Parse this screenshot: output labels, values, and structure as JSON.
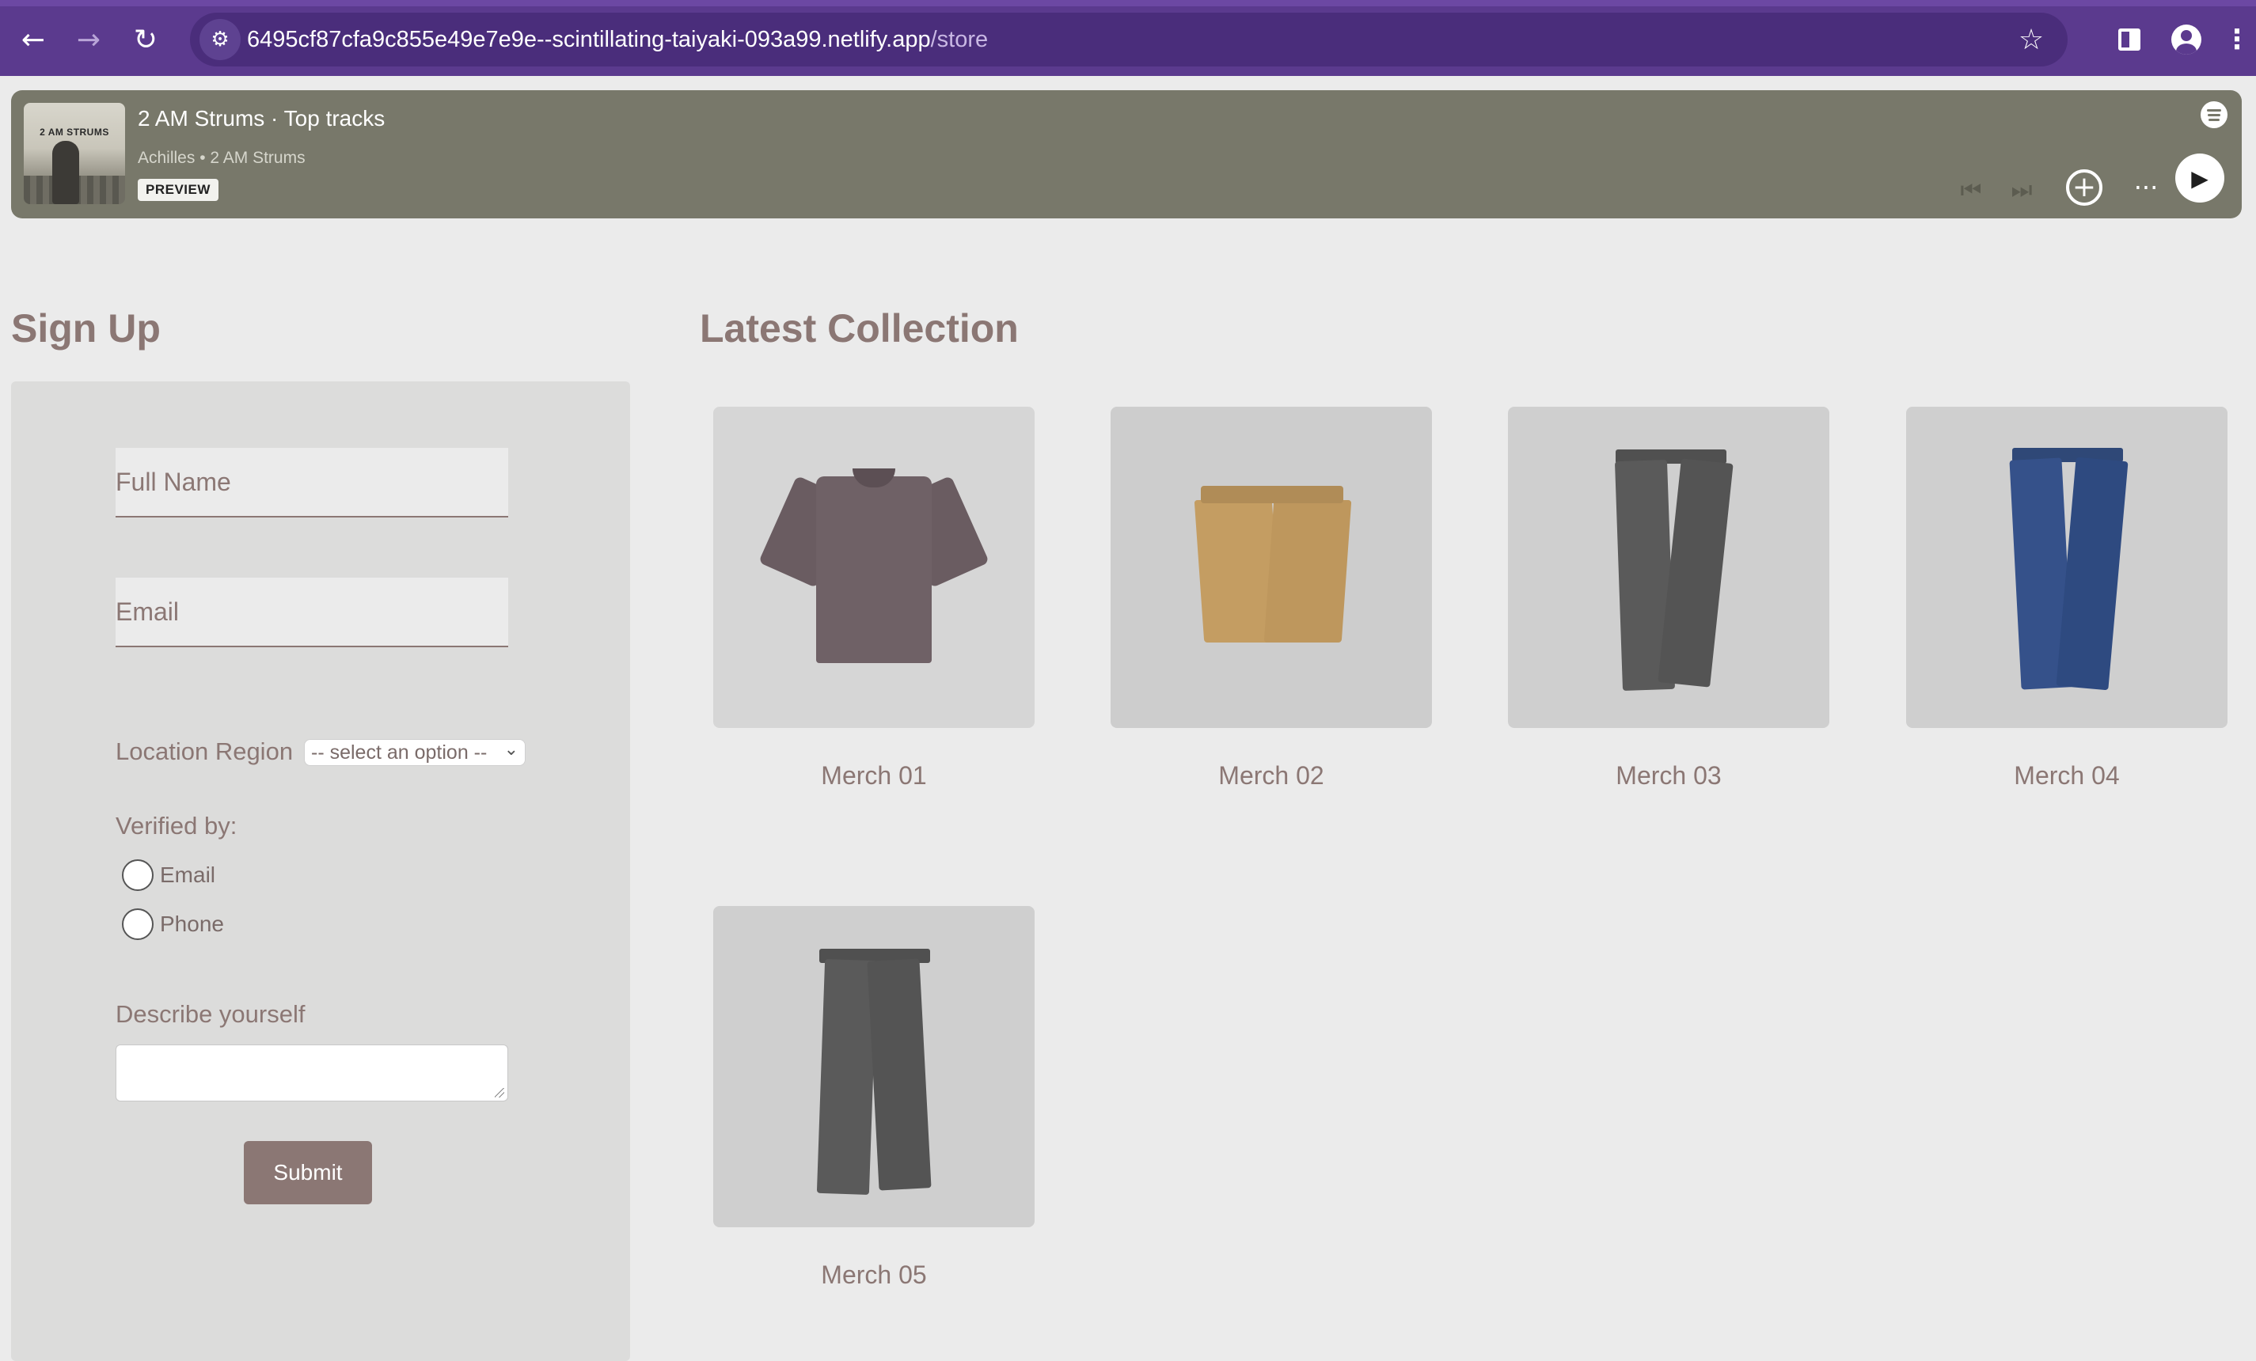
{
  "browser": {
    "url_host": "6495cf87cfa9c855e49e7e9e--scintillating-taiyaki-093a99.netlify.app",
    "url_path": "/store",
    "back_glyph": "←",
    "forward_glyph": "→",
    "reload_glyph": "↻",
    "star_glyph": "☆",
    "more_glyph": "⋮",
    "site_info_glyph": "⚙"
  },
  "player": {
    "album_label": "2 AM STRUMS",
    "title": "2 AM Strums · Top tracks",
    "subtitle": "Achilles • 2 AM Strums",
    "badge": "PREVIEW",
    "prev_glyph": "⏮",
    "next_glyph": "⏭",
    "add_glyph": "+",
    "more_glyph": "···",
    "play_glyph": "▶"
  },
  "signup": {
    "title": "Sign Up",
    "full_name_placeholder": "Full Name",
    "email_placeholder": "Email",
    "region_label": "Location Region",
    "region_selected": "-- select an option --",
    "region_chevron": "⌄",
    "verified_label": "Verified by:",
    "verify_options": [
      "Email",
      "Phone"
    ],
    "describe_label": "Describe yourself",
    "submit_label": "Submit"
  },
  "collection": {
    "title": "Latest Collection",
    "items": [
      {
        "name": "Merch 01"
      },
      {
        "name": "Merch 02"
      },
      {
        "name": "Merch 03"
      },
      {
        "name": "Merch 04"
      },
      {
        "name": "Merch 05"
      }
    ]
  },
  "colors": {
    "chrome": "#5b3a8e",
    "player_bg": "#78786a",
    "accent": "#8b7774",
    "page_bg": "#ebebeb"
  }
}
